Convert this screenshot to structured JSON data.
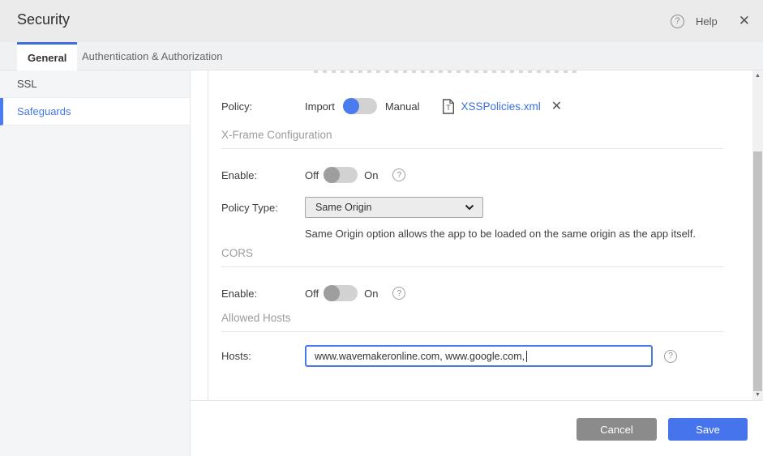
{
  "header": {
    "title": "Security",
    "help_label": "Help",
    "help_icon": "?",
    "close_icon": "✕"
  },
  "tabs": [
    {
      "label": "General",
      "active": true
    },
    {
      "label": "Authentication & Authorization",
      "active": false
    }
  ],
  "sidebar": {
    "items": [
      {
        "label": "SSL",
        "active": false
      },
      {
        "label": "Safeguards",
        "active": true
      }
    ]
  },
  "content": {
    "policy": {
      "label": "Policy:",
      "option_left": "Import",
      "option_right": "Manual",
      "toggle_state": "Import",
      "file_name": "XSSPolicies.xml",
      "remove_icon": "✕"
    },
    "xframe": {
      "section_title": "X-Frame Configuration",
      "enable_label": "Enable:",
      "off_label": "Off",
      "on_label": "On",
      "enable_state": "Off",
      "policy_type_label": "Policy Type:",
      "policy_type_value": "Same Origin",
      "helper_text": "Same Origin option allows the app to be loaded on the same origin as the app itself.",
      "help_icon": "?"
    },
    "cors": {
      "section_title": "CORS",
      "enable_label": "Enable:",
      "off_label": "Off",
      "on_label": "On",
      "enable_state": "Off",
      "help_icon": "?"
    },
    "allowed_hosts": {
      "section_title": "Allowed Hosts",
      "hosts_label": "Hosts:",
      "hosts_value": "www.wavemakeronline.com, www.google.com, ",
      "help_icon": "?"
    }
  },
  "footer": {
    "cancel_label": "Cancel",
    "save_label": "Save"
  },
  "colors": {
    "accent_blue": "#4a7cf0",
    "link_blue": "#3b6fe0",
    "save_blue": "#4674ec",
    "cancel_gray": "#8b8b8b",
    "toggle_track": "#d2d2d2",
    "toggle_off_knob": "#9e9e9e"
  }
}
